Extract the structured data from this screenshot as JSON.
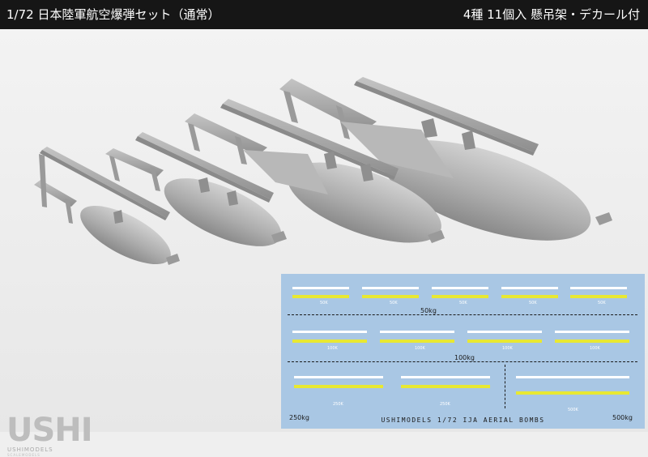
{
  "header": {
    "title": "1/72 日本陸軍航空爆弾セット（通常）",
    "contents": "4種 11個入 懸吊架・デカール付"
  },
  "decal_sheet": {
    "label_50kg": "50kg",
    "label_100kg": "100kg",
    "label_250kg": "250kg",
    "label_500kg": "500kg",
    "mini_50": "50K",
    "mini_100": "100K",
    "mini_250": "250K",
    "mini_500": "500K",
    "caption": "USHIMODELS 1/72 IJA AERIAL BOMBS",
    "colors": {
      "sheet": "#a9c7e4",
      "white_stripe": "#ffffff",
      "yellow_stripe": "#e8e832"
    }
  },
  "brand": {
    "logo": "USHI",
    "name": "USHIMODELS",
    "tagline": "SCALEMODELS"
  },
  "colors": {
    "topbar": "#161616",
    "background": "#efefef",
    "bomb_grey": "#b4b4b4"
  }
}
